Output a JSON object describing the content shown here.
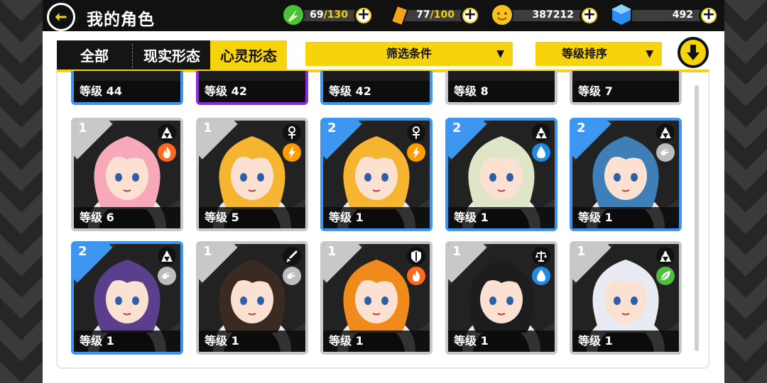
{
  "header": {
    "title": "我的角色",
    "stamina": {
      "current": "69",
      "max": "/130"
    },
    "energy": {
      "current": "77",
      "max": "/100"
    },
    "gold": "387212",
    "gems": "492",
    "plus": "+"
  },
  "tabs": [
    {
      "label": "全部"
    },
    {
      "label": "现实形态"
    },
    {
      "label": "心灵形态"
    }
  ],
  "filters": {
    "condition_label": "筛选条件",
    "sort_label": "等级排序",
    "arrow": "▼"
  },
  "top_row": [
    {
      "level": "等级 44"
    },
    {
      "level": "等级 42"
    },
    {
      "level": "等级 42"
    },
    {
      "level": "等级 8"
    },
    {
      "level": "等级 7"
    }
  ],
  "rows": [
    [
      {
        "rank": "1",
        "level": "等级 6",
        "element": "fire",
        "role": "triforce",
        "hair": "#f7a9b9",
        "frame": "gray"
      },
      {
        "rank": "1",
        "level": "等级 5",
        "element": "bolt",
        "role": "ankh",
        "hair": "#f6b530",
        "frame": "gray"
      },
      {
        "rank": "2",
        "level": "等级 1",
        "element": "bolt",
        "role": "ankh",
        "hair": "#f6b530",
        "frame": "blue"
      },
      {
        "rank": "2",
        "level": "等级 1",
        "element": "water",
        "role": "triforce",
        "hair": "#dfe6c8",
        "frame": "blue"
      },
      {
        "rank": "2",
        "level": "等级 1",
        "element": "wind",
        "role": "triforce",
        "hair": "#3f7fb8",
        "frame": "blue"
      }
    ],
    [
      {
        "rank": "2",
        "level": "等级 1",
        "element": "wind",
        "role": "triforce",
        "hair": "#5a3f8c",
        "frame": "blue"
      },
      {
        "rank": "1",
        "level": "等级 1",
        "element": "wind",
        "role": "sword",
        "hair": "#3b2a22",
        "frame": "gray"
      },
      {
        "rank": "1",
        "level": "等级 1",
        "element": "fire",
        "role": "shield",
        "hair": "#f08a1a",
        "frame": "gray"
      },
      {
        "rank": "1",
        "level": "等级 1",
        "element": "water",
        "role": "scale",
        "hair": "#1d1d1d",
        "frame": "gray"
      },
      {
        "rank": "1",
        "level": "等级 1",
        "element": "leaf",
        "role": "triforce",
        "hair": "#e8ecf2",
        "frame": "gray"
      }
    ]
  ]
}
